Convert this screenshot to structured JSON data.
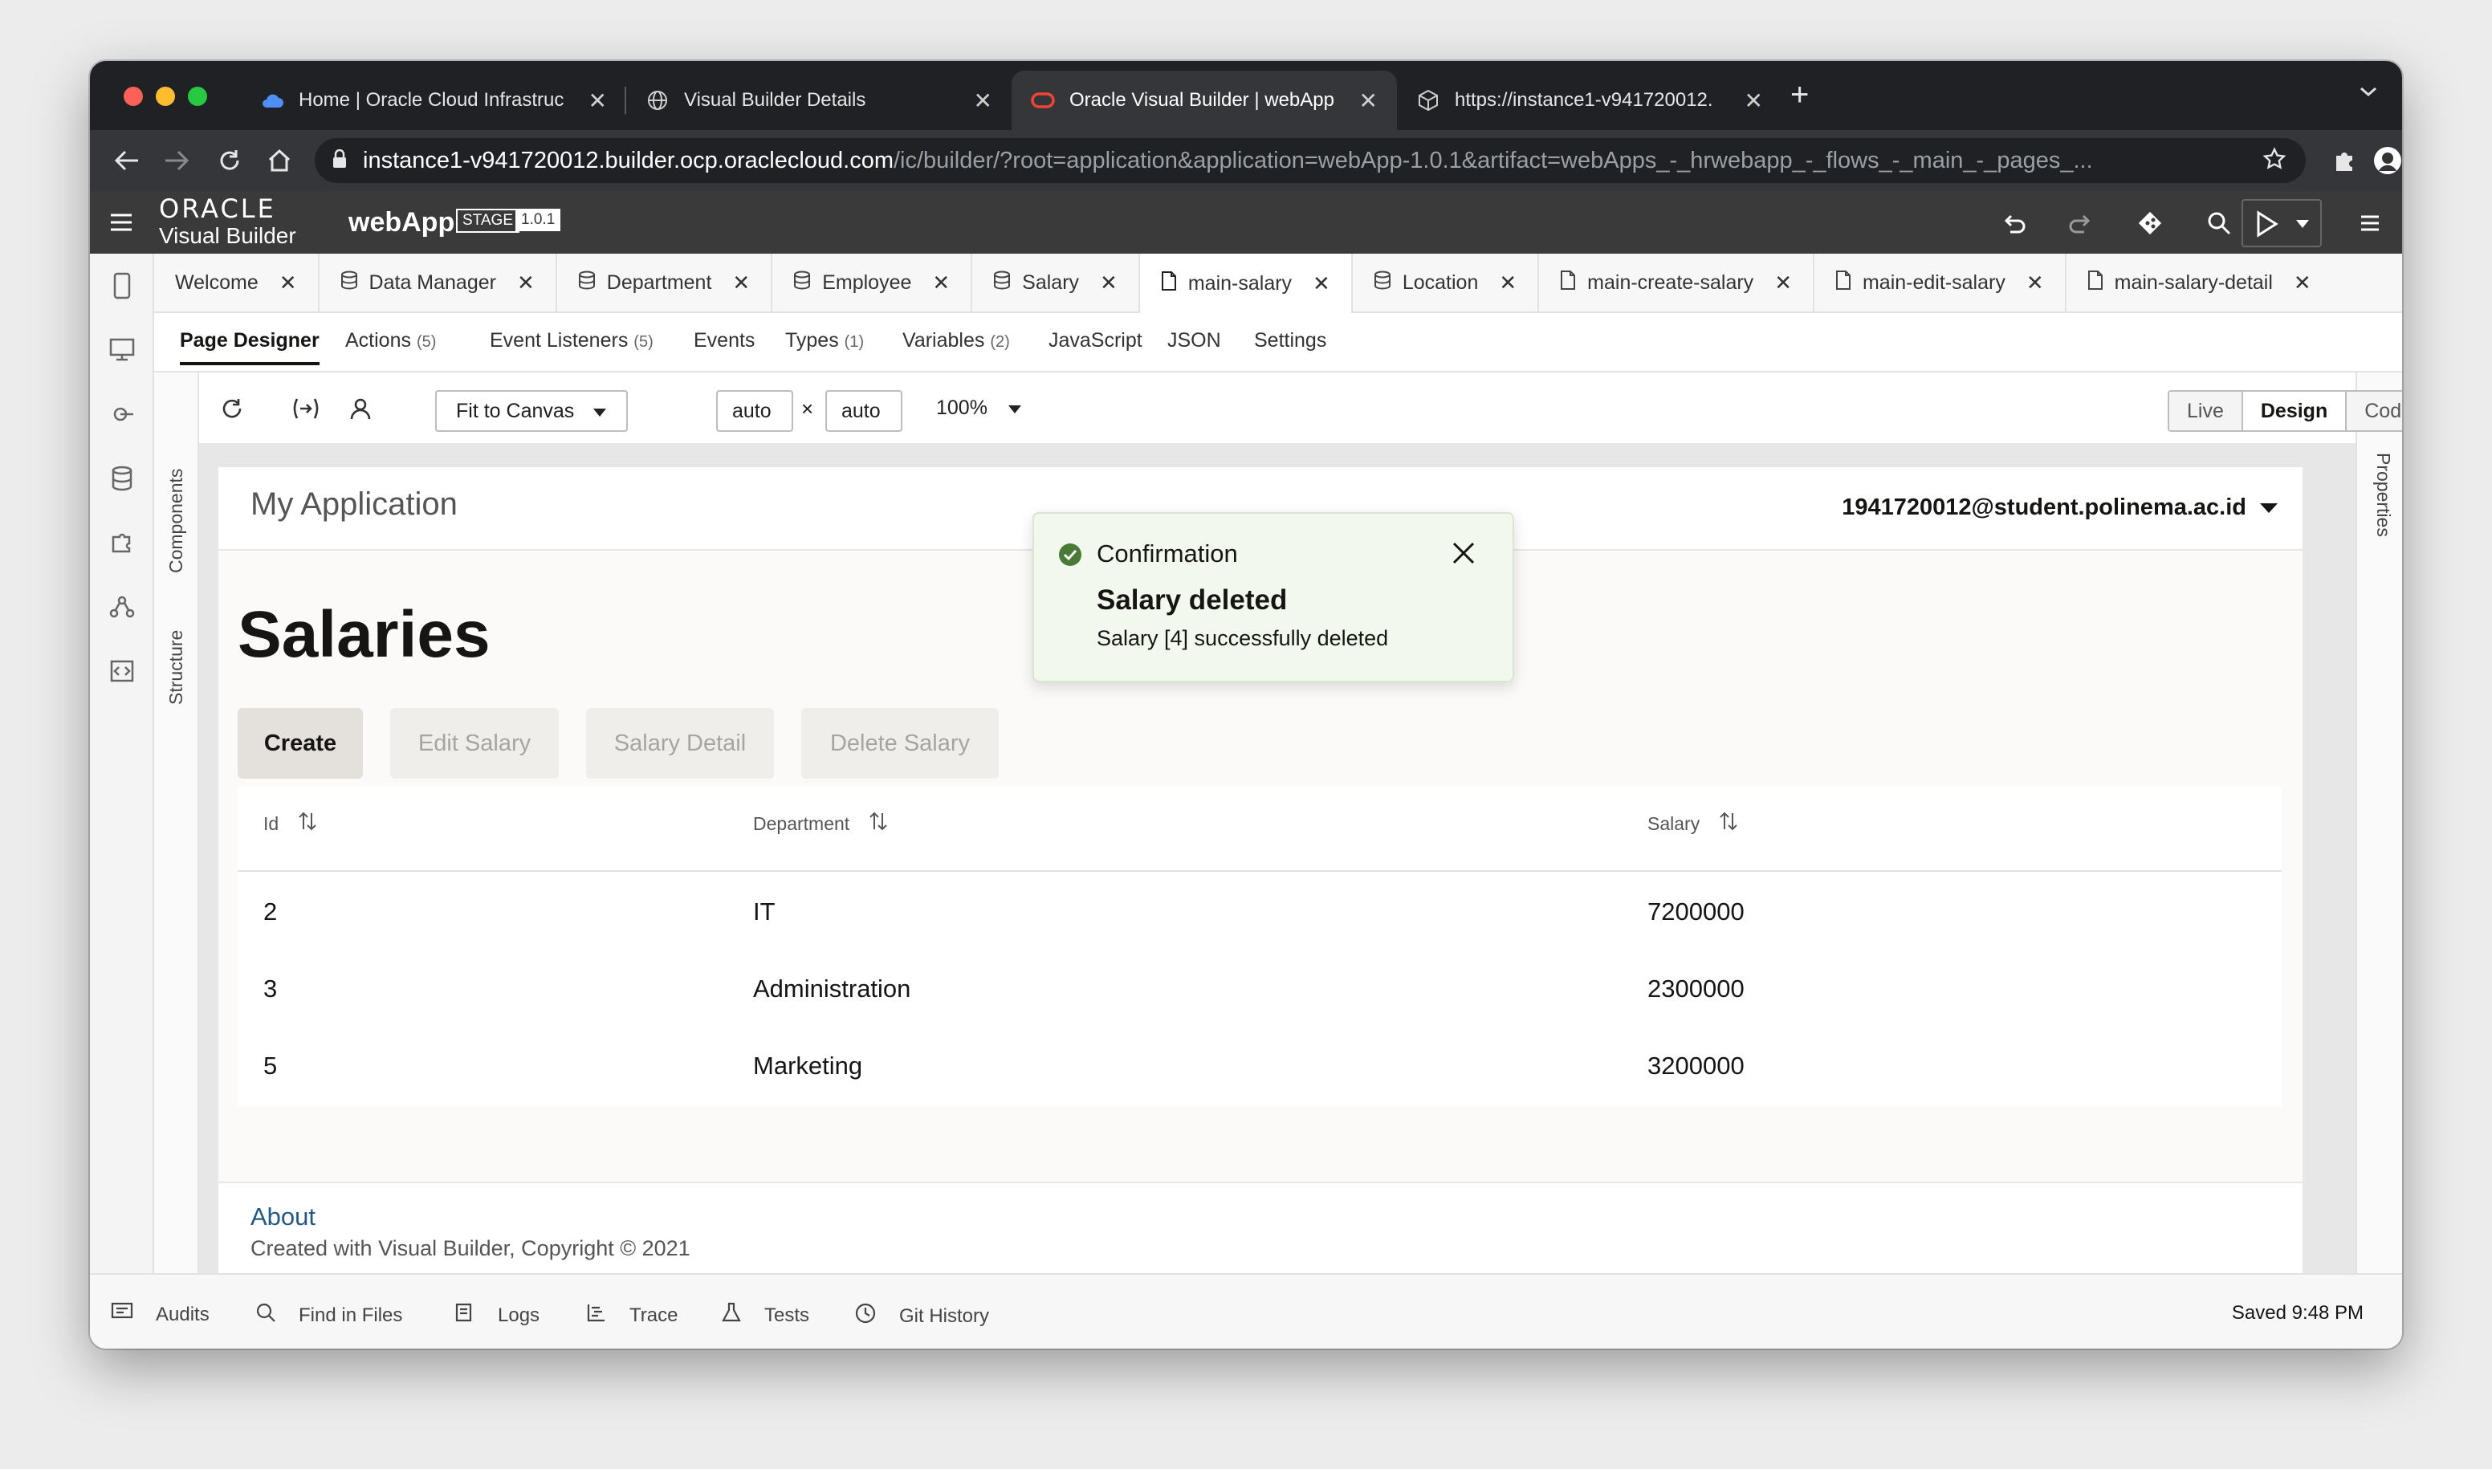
{
  "browser": {
    "tabs": [
      {
        "title": "Home | Oracle Cloud Infrastruc",
        "favicon": "cloud-icon",
        "active": false
      },
      {
        "title": "Visual Builder Details",
        "favicon": "globe-icon",
        "active": false
      },
      {
        "title": "Oracle Visual Builder | webApp",
        "favicon": "oracle-icon",
        "active": true
      },
      {
        "title": "https://instance1-v941720012.",
        "favicon": "cube-icon",
        "active": false
      }
    ],
    "url_host": "instance1-v941720012.builder.ocp.oraclecloud.com",
    "url_path": "/ic/builder/?root=application&application=webApp-1.0.1&artifact=webApps_-_hrwebapp_-_flows_-_main_-_pages_..."
  },
  "app": {
    "logo_top": "ORACLE",
    "logo_bottom": "Visual Builder",
    "name": "webApp",
    "stage": "STAGE",
    "version": "1.0.1"
  },
  "artifact_tabs": [
    {
      "label": "Welcome",
      "icon": "",
      "active": false
    },
    {
      "label": "Data Manager",
      "icon": "database-icon",
      "active": false
    },
    {
      "label": "Department",
      "icon": "database-icon",
      "active": false
    },
    {
      "label": "Employee",
      "icon": "database-icon",
      "active": false
    },
    {
      "label": "Salary",
      "icon": "database-icon",
      "active": false
    },
    {
      "label": "main-salary",
      "icon": "page-icon",
      "active": true
    },
    {
      "label": "Location",
      "icon": "database-icon",
      "active": false
    },
    {
      "label": "main-create-salary",
      "icon": "page-icon",
      "active": false
    },
    {
      "label": "main-edit-salary",
      "icon": "page-icon",
      "active": false
    },
    {
      "label": "main-salary-detail",
      "icon": "page-icon",
      "active": false
    }
  ],
  "designer_tabs": [
    {
      "label": "Page Designer",
      "count": ""
    },
    {
      "label": "Actions",
      "count": "(5)"
    },
    {
      "label": "Event Listeners",
      "count": "(5)"
    },
    {
      "label": "Events",
      "count": ""
    },
    {
      "label": "Types",
      "count": "(1)"
    },
    {
      "label": "Variables",
      "count": "(2)"
    },
    {
      "label": "JavaScript",
      "count": ""
    },
    {
      "label": "JSON",
      "count": ""
    },
    {
      "label": "Settings",
      "count": ""
    }
  ],
  "side": {
    "components": "Components",
    "structure": "Structure",
    "properties": "Properties"
  },
  "toolbar": {
    "fit": "Fit to Canvas",
    "width": "auto",
    "height": "auto",
    "times": "×",
    "zoom": "100%",
    "modes": [
      "Live",
      "Design",
      "Code"
    ]
  },
  "page": {
    "app_title": "My Application",
    "user": "1941720012@student.polinema.ac.id",
    "heading": "Salaries",
    "buttons": [
      "Create",
      "Edit Salary",
      "Salary Detail",
      "Delete Salary"
    ],
    "table": {
      "columns": [
        "Id",
        "Department",
        "Salary"
      ],
      "rows": [
        [
          "2",
          "IT",
          "7200000"
        ],
        [
          "3",
          "Administration",
          "2300000"
        ],
        [
          "5",
          "Marketing",
          "3200000"
        ]
      ]
    },
    "footer": {
      "about": "About",
      "copyright": "Created with Visual Builder, Copyright © 2021"
    }
  },
  "toast": {
    "title": "Confirmation",
    "summary": "Salary deleted",
    "detail": "Salary [4] successfully deleted"
  },
  "status": {
    "items": [
      "Audits",
      "Find in Files",
      "Logs",
      "Trace",
      "Tests",
      "Git History"
    ],
    "saved": "Saved 9:48 PM"
  },
  "colors": {
    "chrome_dark": "#1f2124",
    "chrome_toolbar": "#35363a",
    "app_header": "#3a3a3a",
    "toast_bg": "#f2f8ed",
    "success": "#4a7a37",
    "link": "#235886"
  }
}
